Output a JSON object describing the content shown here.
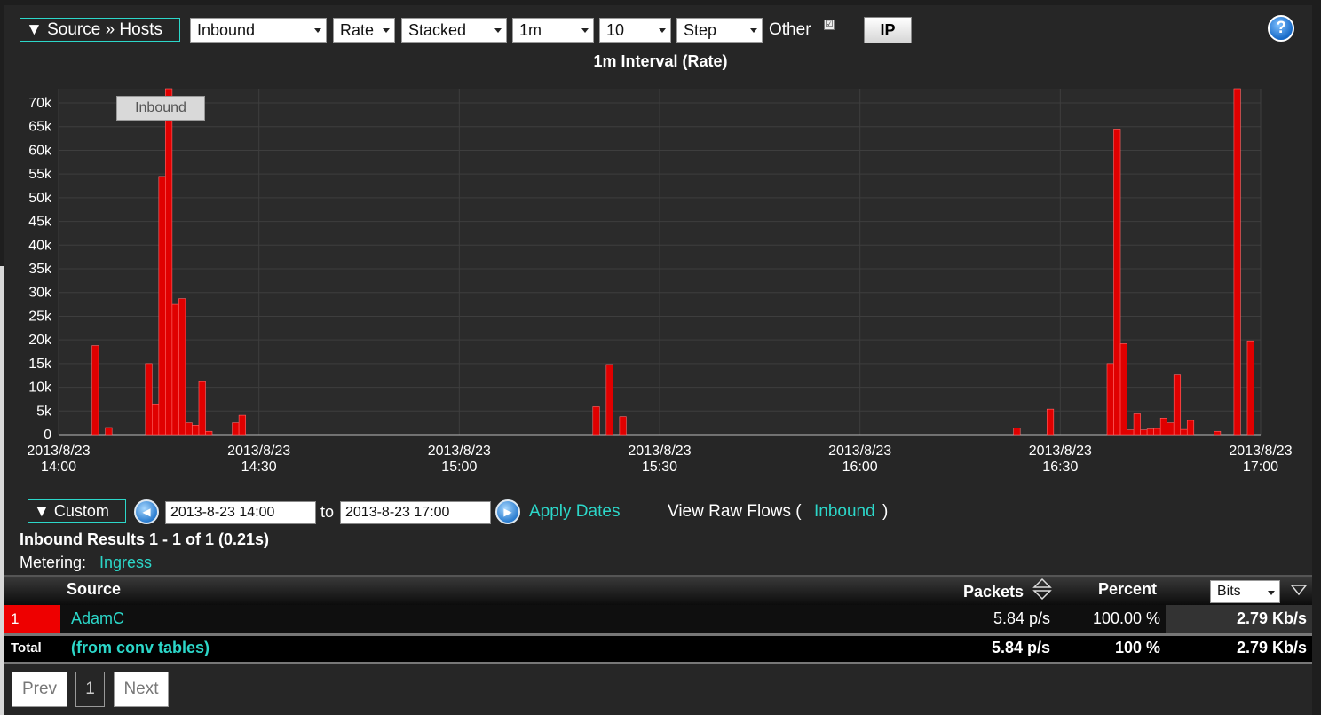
{
  "toolbar": {
    "report_toggle": "▼ Source » Hosts",
    "direction": "Inbound",
    "metric": "Rate",
    "graph_type": "Stacked",
    "interval": "1m",
    "count": "10",
    "line_style": "Step",
    "other_label": "Other",
    "other_checked": "☑",
    "ip_button": "IP",
    "help_icon": "?"
  },
  "chart_data": {
    "type": "bar",
    "title": "1m Interval (Rate)",
    "series": [
      {
        "name": "Inbound",
        "color": "#e00000"
      }
    ],
    "tooltip": "Inbound",
    "ylim": [
      0,
      73000
    ],
    "y_ticks": [
      {
        "v": 0,
        "label": "0"
      },
      {
        "v": 5000,
        "label": "5k"
      },
      {
        "v": 10000,
        "label": "10k"
      },
      {
        "v": 15000,
        "label": "15k"
      },
      {
        "v": 20000,
        "label": "20k"
      },
      {
        "v": 25000,
        "label": "25k"
      },
      {
        "v": 30000,
        "label": "30k"
      },
      {
        "v": 35000,
        "label": "35k"
      },
      {
        "v": 40000,
        "label": "40k"
      },
      {
        "v": 45000,
        "label": "45k"
      },
      {
        "v": 50000,
        "label": "50k"
      },
      {
        "v": 55000,
        "label": "55k"
      },
      {
        "v": 60000,
        "label": "60k"
      },
      {
        "v": 65000,
        "label": "65k"
      },
      {
        "v": 70000,
        "label": "70k"
      }
    ],
    "x_ticks": [
      {
        "v": 0,
        "date": "2013/8/23",
        "time": "14:00"
      },
      {
        "v": 30,
        "date": "2013/8/23",
        "time": "14:30"
      },
      {
        "v": 60,
        "date": "2013/8/23",
        "time": "15:00"
      },
      {
        "v": 90,
        "date": "2013/8/23",
        "time": "15:30"
      },
      {
        "v": 120,
        "date": "2013/8/23",
        "time": "16:00"
      },
      {
        "v": 150,
        "date": "2013/8/23",
        "time": "16:30"
      },
      {
        "v": 180,
        "date": "2013/8/23",
        "time": "17:00"
      }
    ],
    "xlim": [
      0,
      180
    ],
    "points": [
      [
        5,
        18800
      ],
      [
        7,
        1500
      ],
      [
        13,
        15000
      ],
      [
        14,
        6500
      ],
      [
        15,
        54500
      ],
      [
        16,
        73000
      ],
      [
        17,
        27500
      ],
      [
        18,
        28700
      ],
      [
        19,
        2500
      ],
      [
        20,
        2000
      ],
      [
        21,
        11200
      ],
      [
        22,
        700
      ],
      [
        26,
        2500
      ],
      [
        27,
        4100
      ],
      [
        80,
        5900
      ],
      [
        82,
        14800
      ],
      [
        84,
        3800
      ],
      [
        143,
        1400
      ],
      [
        148,
        5400
      ],
      [
        157,
        15000
      ],
      [
        158,
        64500
      ],
      [
        159,
        19200
      ],
      [
        160,
        1000
      ],
      [
        161,
        4400
      ],
      [
        162,
        1000
      ],
      [
        163,
        1200
      ],
      [
        164,
        1300
      ],
      [
        165,
        3500
      ],
      [
        166,
        2500
      ],
      [
        167,
        12600
      ],
      [
        168,
        1100
      ],
      [
        169,
        3000
      ],
      [
        173,
        700
      ],
      [
        176,
        73000
      ],
      [
        178,
        19800
      ]
    ],
    "grid": true
  },
  "dates": {
    "range_toggle": "▼  Custom",
    "from": "2013-8-23 14:00",
    "to_label": "to",
    "to": "2013-8-23 17:00",
    "apply": "Apply Dates",
    "raw_prefix": "View Raw Flows (",
    "raw_link": "Inbound",
    "raw_suffix": ")"
  },
  "results": {
    "summary": "Inbound Results 1 - 1 of 1 (0.21s)",
    "metering_label": "Metering:",
    "metering_value": "Ingress"
  },
  "table": {
    "headers": {
      "source": "Source",
      "packets": "Packets",
      "percent": "Percent",
      "units": "Bits"
    },
    "row": {
      "rank": "1",
      "name": "AdamC",
      "packets": "5.84 p/s",
      "percent": "100.00 %",
      "bits": "2.79 Kb/s"
    },
    "total": {
      "label": "Total",
      "name": "(from conv tables)",
      "packets": "5.84 p/s",
      "percent": "100 %",
      "bits": "2.79 Kb/s"
    }
  },
  "pager": {
    "prev": "Prev",
    "page": "1",
    "next": "Next"
  }
}
